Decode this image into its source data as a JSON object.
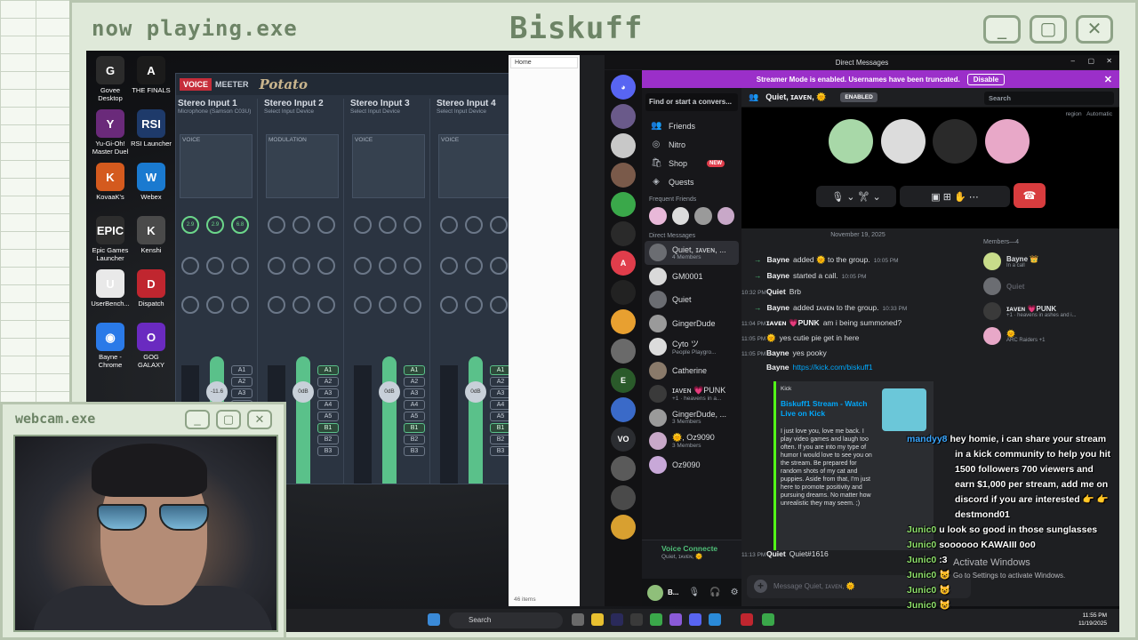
{
  "frame": {
    "title": "now playing.exe",
    "name": "Biskuff",
    "btn_min": "_",
    "btn_max": "▢",
    "btn_close": "✕"
  },
  "desktop_icons": [
    {
      "label": "Govee Desktop",
      "glyph": "G",
      "color": "#2b2b2b"
    },
    {
      "label": "THE FINALS",
      "glyph": "A",
      "color": "#1b1b1b"
    },
    {
      "label": "Yu-Gi-Oh! Master Duel",
      "glyph": "Y",
      "color": "#6a2a7a"
    },
    {
      "label": "RSI Launcher",
      "glyph": "RSI",
      "color": "#1e3a6a"
    },
    {
      "label": "KovaaK's",
      "glyph": "K",
      "color": "#d45a1e"
    },
    {
      "label": "Webex",
      "glyph": "W",
      "color": "#1a7ad0"
    },
    {
      "label": "Epic Games Launcher",
      "glyph": "EPIC",
      "color": "#2d2d2d"
    },
    {
      "label": "Kenshi",
      "glyph": "K",
      "color": "#4a4a4a"
    },
    {
      "label": "UserBench...",
      "glyph": "U",
      "color": "#e9e9e9"
    },
    {
      "label": "Dispatch",
      "glyph": "D",
      "color": "#c0262f"
    },
    {
      "label": "Bayne - Chrome",
      "glyph": "◉",
      "color": "#2a7ae8"
    },
    {
      "label": "GOG GALAXY",
      "glyph": "O",
      "color": "#6a2ac0"
    }
  ],
  "voicemeeter": {
    "logo_a": "VOICE",
    "logo_b": "MEETER",
    "logo_c": "Potato",
    "strips": [
      {
        "name": "Stereo Input 1",
        "device": "Microphone (Samson C03U)"
      },
      {
        "name": "Stereo Input 2",
        "device": "Select Input Device"
      },
      {
        "name": "Stereo Input 3",
        "device": "Select Input Device"
      },
      {
        "name": "Stereo Input 4",
        "device": "Select Input Device"
      },
      {
        "name": "Stereo Input 5",
        "device": "Select Input Device"
      }
    ],
    "panel_labels": [
      "VOICE",
      "MODULATION",
      "VOICE",
      "VOICE",
      "VOICE"
    ],
    "fader_values": [
      "-11.6",
      "0dB",
      "0dB",
      "0dB",
      "0dB"
    ],
    "bus_labels": [
      "A1",
      "A2",
      "A3",
      "A4",
      "A5",
      "B1",
      "B2",
      "B3"
    ],
    "fader_gain": "Fader Gain",
    "knob_values": [
      "2.9",
      "2.9",
      "6.8"
    ]
  },
  "explorer": {
    "tab": "Home",
    "items": "46 items"
  },
  "discord": {
    "window_title": "Direct Messages",
    "banner_text": "Streamer Mode is enabled. Usernames have been truncated.",
    "banner_button": "Disable",
    "find_placeholder": "Find or start a convers...",
    "nav": [
      {
        "label": "Friends",
        "icon": "people-icon",
        "glyph": "👥"
      },
      {
        "label": "Nitro",
        "icon": "nitro-icon",
        "glyph": "◎"
      },
      {
        "label": "Shop",
        "icon": "shop-icon",
        "glyph": "🛍",
        "badge": "NEW"
      },
      {
        "label": "Quests",
        "icon": "quests-icon",
        "glyph": "◈"
      }
    ],
    "frequent_friends": "Frequent Friends",
    "direct_messages": "Direct Messages",
    "dms": [
      {
        "name": "Quiet, ɪᴀᴠᴇɴ, ...",
        "sub": "4 Members",
        "color": "#6b6d72"
      },
      {
        "name": "GM0001",
        "sub": "",
        "color": "#d9d9d9"
      },
      {
        "name": "Quiet",
        "sub": "",
        "color": "#6b6d72"
      },
      {
        "name": "GingerDude",
        "sub": "",
        "color": "#9a9a9a"
      },
      {
        "name": "Cyto ツ",
        "sub": "People Playgro...",
        "color": "#dcdcdc"
      },
      {
        "name": "Catherine",
        "sub": "",
        "color": "#8a7a6a"
      },
      {
        "name": "ɪᴀᴠᴇɴ 💗PUNK",
        "sub": "+1 · heavens in a...",
        "color": "#3a3a3a"
      },
      {
        "name": "GingerDude, ...",
        "sub": "3 Members",
        "color": "#9a9a9a"
      },
      {
        "name": "🌞, Oz9090",
        "sub": "3 Members",
        "color": "#c8a8c8"
      },
      {
        "name": "Oz9090",
        "sub": "",
        "color": "#c8a8d8"
      }
    ],
    "voice_connected": "Voice Connecte",
    "voice_sub": "Quiet, ɪᴀᴠᴇɴ, 🌞",
    "user_name": "B...",
    "header_name": "Quiet, ɪᴀᴠᴇɴ, 🌞",
    "header_badge": "ENABLED",
    "search_placeholder": "Search",
    "region_label": "region",
    "region_value": "Automatic",
    "date_divider": "November 19, 2025",
    "messages": [
      {
        "type": "sys",
        "user": "Bayne",
        "text": "added 🌞 to the group.",
        "time": "10:05 PM"
      },
      {
        "type": "sys",
        "user": "Bayne",
        "text": "started a call.",
        "time": "10:05 PM"
      },
      {
        "type": "msg",
        "time": "10:32 PM",
        "user": "Quiet",
        "text": "Brb"
      },
      {
        "type": "sys",
        "user": "Bayne",
        "text": "added ɪᴀᴠᴇɴ to the group.",
        "time": "10:33 PM"
      },
      {
        "type": "msg",
        "time": "11:04 PM",
        "user": "ɪᴀᴠᴇɴ 💗PUNK",
        "text": "am i being summoned?"
      },
      {
        "type": "msg",
        "time": "11:05 PM",
        "user": "🌞",
        "text": "yes cutie pie get in here"
      },
      {
        "type": "msg",
        "time": "11:05 PM",
        "user": "Bayne",
        "text": "yes pooky"
      },
      {
        "type": "link",
        "time": "",
        "user": "Bayne",
        "text": "https://kick.com/biskuff1"
      },
      {
        "type": "msg",
        "time": "11:13 PM",
        "user": "Quiet",
        "text": "Quiet#1616"
      }
    ],
    "embed": {
      "provider": "Kick",
      "title": "Biskuff1 Stream - Watch Live on Kick",
      "description": "I just love you, love me back. I play video games and laugh too often. If you are into my type of humor I would love to see you on the stream. Be prepared for random shots of my cat and puppies. Aside from that, I'm just here to promote positivity and pursuing dreams. No matter how unrealistic they may seem. ;)"
    },
    "input_placeholder": "Message Quiet, ɪᴀᴠᴇɴ, 🌞",
    "members_header": "Members—4",
    "members": [
      {
        "name": "Bayne 👑",
        "sub": "In a call",
        "color": "#c8dc8a",
        "faded": false
      },
      {
        "name": "Quiet",
        "sub": "",
        "color": "#6b6d72",
        "faded": true
      },
      {
        "name": "ɪᴀᴠᴇɴ 💗PUNK",
        "sub": "+1 · heavens in ashes and i...",
        "color": "#3a3a3a",
        "faded": false
      },
      {
        "name": "🌞",
        "sub": "ARC Raiders +1",
        "color": "#e8a8c8",
        "faded": false
      }
    ]
  },
  "kick_chat": [
    {
      "user": "mandyy8",
      "text": "hey homie, i can share your stream"
    },
    {
      "user": "",
      "text": "in a kick community to help you hit"
    },
    {
      "user": "",
      "text": "1500 followers 700 viewers and"
    },
    {
      "user": "",
      "text": "earn $1,000 per stream, add me on"
    },
    {
      "user": "",
      "text": "discord if you are interested 👉 👉"
    },
    {
      "user": "",
      "text": "destmond01"
    },
    {
      "user": "Junic0",
      "text": "u look so good in those sunglasses"
    },
    {
      "user": "Junic0",
      "text": "soooooo KAWAIII 0o0"
    },
    {
      "user": "Junic0",
      "text": ":3"
    },
    {
      "user": "Junic0",
      "text": "😺"
    },
    {
      "user": "Junic0",
      "text": "😺"
    },
    {
      "user": "Junic0",
      "text": "😺"
    }
  ],
  "activate": {
    "title": "Activate Windows",
    "sub": "Go to Settings to activate Windows."
  },
  "taskbar": {
    "search": "Search",
    "time": "11:55 PM",
    "date": "11/19/2025"
  },
  "webcam": {
    "title": "webcam.exe",
    "btn_min": "_",
    "btn_max": "▢",
    "btn_close": "✕"
  }
}
